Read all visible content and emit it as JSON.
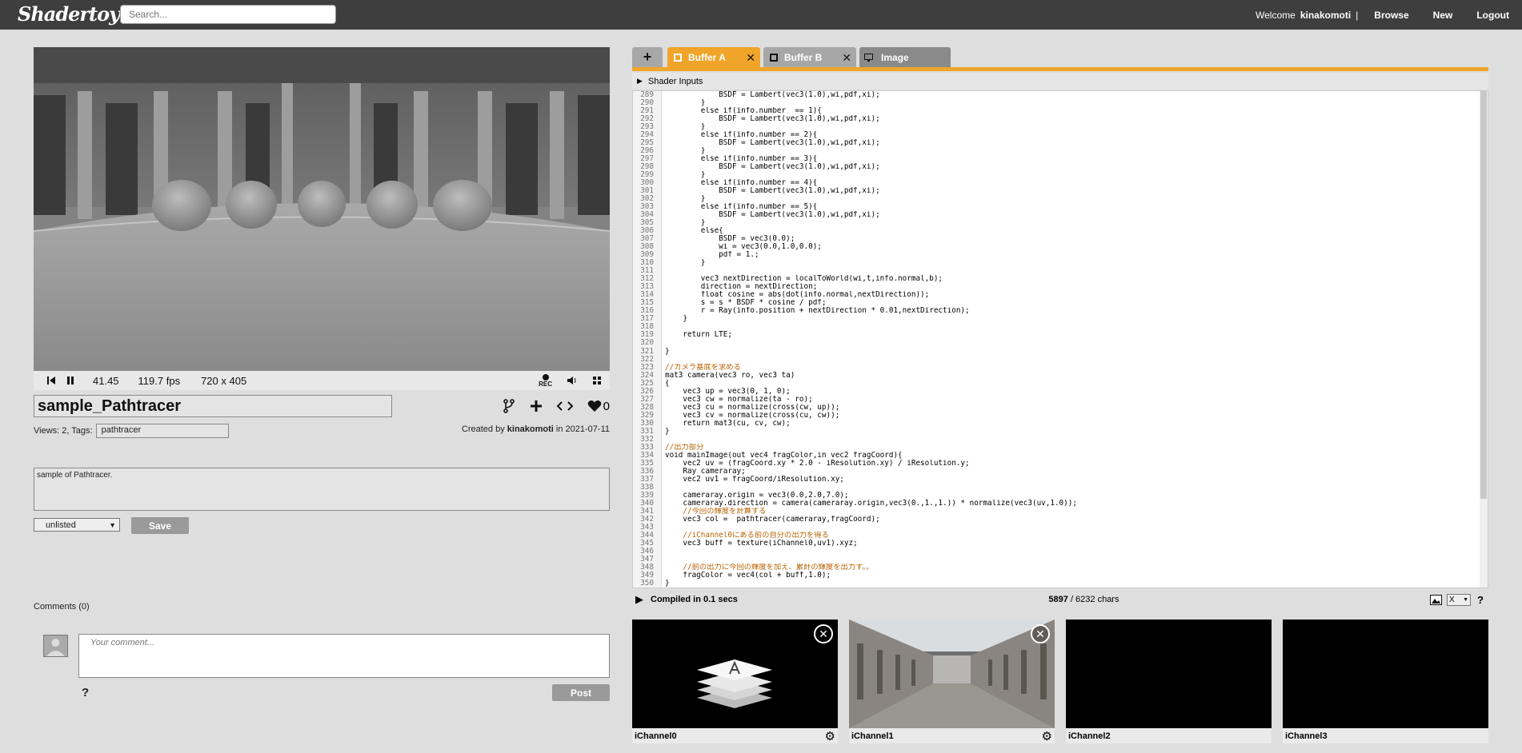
{
  "header": {
    "logo": "Shadertoy",
    "search_placeholder": "Search...",
    "welcome": "Welcome",
    "username": "kinakomoti",
    "separator": "|",
    "browse": "Browse",
    "new": "New",
    "logout": "Logout"
  },
  "player": {
    "time": "41.45",
    "fps": "119.7 fps",
    "resolution": "720 x 405",
    "rec_label": "REC"
  },
  "shader": {
    "title": "sample_Pathtracer",
    "views_label": "Views: 2, Tags:",
    "tag": "pathtracer",
    "likes": "0",
    "created_prefix": "Created by",
    "author": "kinakomoti",
    "created_mid": "in",
    "date": "2021-07-11",
    "description": "sample of Pathtracer.",
    "visibility": "unlisted",
    "save": "Save"
  },
  "comments": {
    "title": "Comments (0)",
    "placeholder": "Your comment...",
    "help": "?",
    "post": "Post"
  },
  "tabs": {
    "add": "+",
    "buffer_a": "Buffer A",
    "buffer_b": "Buffer B",
    "image": "Image",
    "close": "✕"
  },
  "editor": {
    "shader_inputs": "Shader Inputs",
    "compiled": "Compiled in 0.1 secs",
    "chars_used": "5897",
    "chars_sep": "/ 6232 chars",
    "font_select": "X",
    "help": "?",
    "lines": [
      {
        "n": "289",
        "t": "            BSDF = Lambert(vec3(1.0),wi,pdf,xi);"
      },
      {
        "n": "290",
        "t": "        }"
      },
      {
        "n": "291",
        "t": "        else if(info.number  == 1){"
      },
      {
        "n": "292",
        "t": "            BSDF = Lambert(vec3(1.0),wi,pdf,xi);"
      },
      {
        "n": "293",
        "t": "        }"
      },
      {
        "n": "294",
        "t": "        else if(info.number == 2){"
      },
      {
        "n": "295",
        "t": "            BSDF = Lambert(vec3(1.0),wi,pdf,xi);"
      },
      {
        "n": "296",
        "t": "        }"
      },
      {
        "n": "297",
        "t": "        else if(info.number == 3){"
      },
      {
        "n": "298",
        "t": "            BSDF = Lambert(vec3(1.0),wi,pdf,xi);"
      },
      {
        "n": "299",
        "t": "        }"
      },
      {
        "n": "300",
        "t": "        else if(info.number == 4){"
      },
      {
        "n": "301",
        "t": "            BSDF = Lambert(vec3(1.0),wi,pdf,xi);"
      },
      {
        "n": "302",
        "t": "        }"
      },
      {
        "n": "303",
        "t": "        else if(info.number == 5){"
      },
      {
        "n": "304",
        "t": "            BSDF = Lambert(vec3(1.0),wi,pdf,xi);"
      },
      {
        "n": "305",
        "t": "        }"
      },
      {
        "n": "306",
        "t": "        else{"
      },
      {
        "n": "307",
        "t": "            BSDF = vec3(0.0);"
      },
      {
        "n": "308",
        "t": "            wi = vec3(0.0,1.0,0.0);"
      },
      {
        "n": "309",
        "t": "            pdf = 1.;"
      },
      {
        "n": "310",
        "t": "        }"
      },
      {
        "n": "311",
        "t": ""
      },
      {
        "n": "312",
        "t": "        vec3 nextDirection = localToWorld(wi,t,info.normal,b);"
      },
      {
        "n": "313",
        "t": "        direction = nextDirection;"
      },
      {
        "n": "314",
        "t": "        float cosine = abs(dot(info.normal,nextDirection));"
      },
      {
        "n": "315",
        "t": "        s = s * BSDF * cosine / pdf;"
      },
      {
        "n": "316",
        "t": "        r = Ray(info.position + nextDirection * 0.01,nextDirection);"
      },
      {
        "n": "317",
        "t": "    }"
      },
      {
        "n": "318",
        "t": ""
      },
      {
        "n": "319",
        "t": "    return LTE;"
      },
      {
        "n": "320",
        "t": ""
      },
      {
        "n": "321",
        "t": "}"
      },
      {
        "n": "322",
        "t": ""
      },
      {
        "n": "323",
        "t": "//カメラ基底を求める"
      },
      {
        "n": "324",
        "t": "mat3 camera(vec3 ro, vec3 ta)"
      },
      {
        "n": "325",
        "t": "{"
      },
      {
        "n": "326",
        "t": "    vec3 up = vec3(0, 1, 0);"
      },
      {
        "n": "327",
        "t": "    vec3 cw = normalize(ta - ro);"
      },
      {
        "n": "328",
        "t": "    vec3 cu = normalize(cross(cw, up));"
      },
      {
        "n": "329",
        "t": "    vec3 cv = normalize(cross(cu, cw));"
      },
      {
        "n": "330",
        "t": "    return mat3(cu, cv, cw);"
      },
      {
        "n": "331",
        "t": "}"
      },
      {
        "n": "332",
        "t": ""
      },
      {
        "n": "333",
        "t": "//出力部分"
      },
      {
        "n": "334",
        "t": "void mainImage(out vec4 fragColor,in vec2 fragCoord){"
      },
      {
        "n": "335",
        "t": "    vec2 uv = (fragCoord.xy * 2.0 - iResolution.xy) / iResolution.y;"
      },
      {
        "n": "336",
        "t": "    Ray cameraray;"
      },
      {
        "n": "337",
        "t": "    vec2 uv1 = fragCoord/iResolution.xy;"
      },
      {
        "n": "338",
        "t": ""
      },
      {
        "n": "339",
        "t": "    cameraray.origin = vec3(0.0,2.0,7.0);"
      },
      {
        "n": "340",
        "t": "    cameraray.direction = camera(cameraray.origin,vec3(0.,1.,1.)) * normalize(vec3(uv,1.0));"
      },
      {
        "n": "341",
        "t": "    //今回の輝度を計算する"
      },
      {
        "n": "342",
        "t": "    vec3 col =  pathtracer(cameraray,fragCoord);"
      },
      {
        "n": "343",
        "t": ""
      },
      {
        "n": "344",
        "t": "    //iChannel0にある前の自分の出力を得る"
      },
      {
        "n": "345",
        "t": "    vec3 buff = texture(iChannel0,uv1).xyz;"
      },
      {
        "n": "346",
        "t": ""
      },
      {
        "n": "347",
        "t": ""
      },
      {
        "n": "348",
        "t": "    //前の出力に今回の輝度を加え、累計の輝度を出力す。。"
      },
      {
        "n": "349",
        "t": "    fragColor = vec4(col + buff,1.0);"
      },
      {
        "n": "350",
        "t": "}"
      }
    ]
  },
  "channels": [
    {
      "label": "iChannel0"
    },
    {
      "label": "iChannel1"
    },
    {
      "label": "iChannel2"
    },
    {
      "label": "iChannel3"
    }
  ],
  "colors": {
    "accent": "#f0a52a",
    "topbar": "#3e3e3e"
  }
}
